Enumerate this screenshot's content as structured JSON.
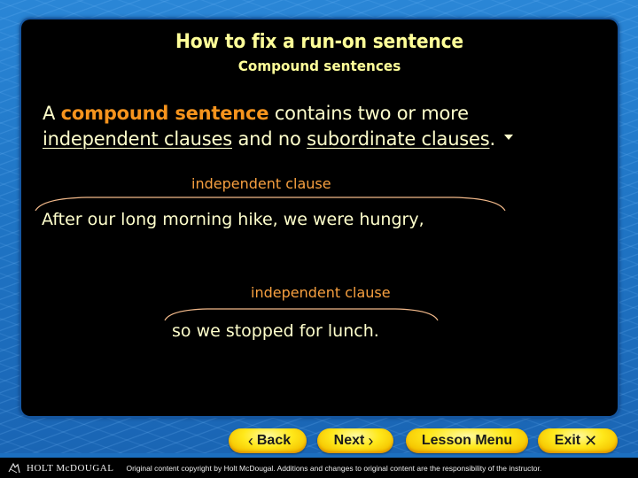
{
  "slide": {
    "title": "How to fix a run-on sentence",
    "subtitle": "Compound sentences",
    "definition": {
      "prefix": "A ",
      "term": "compound sentence",
      "middle": " contains two or more",
      "u1": "independent clauses",
      "and": " and no ",
      "u2": "subordinate clauses",
      "end": "."
    },
    "examples": [
      {
        "label": "independent clause",
        "sentence": "After our long morning hike, we were hungry,"
      },
      {
        "label": "independent clause",
        "sentence": "so we stopped for lunch."
      }
    ],
    "colors": {
      "title": "#ffff99",
      "term": "#f7941d",
      "label": "#f7a040",
      "text": "#ffffcc",
      "panel": "#000000",
      "background": "#1f74c4",
      "button": "#ffe81a"
    }
  },
  "nav": {
    "back": {
      "label": "Back",
      "icon": "‹"
    },
    "next": {
      "label": "Next",
      "icon": "›"
    },
    "menu": {
      "label": "Lesson Menu"
    },
    "exit": {
      "label": "Exit",
      "icon": "✕"
    }
  },
  "footer": {
    "brand": "HOLT McDOUGAL",
    "copyright": "Original content copyright by Holt McDougal.  Additions and changes to original content are the responsibility of the instructor."
  }
}
